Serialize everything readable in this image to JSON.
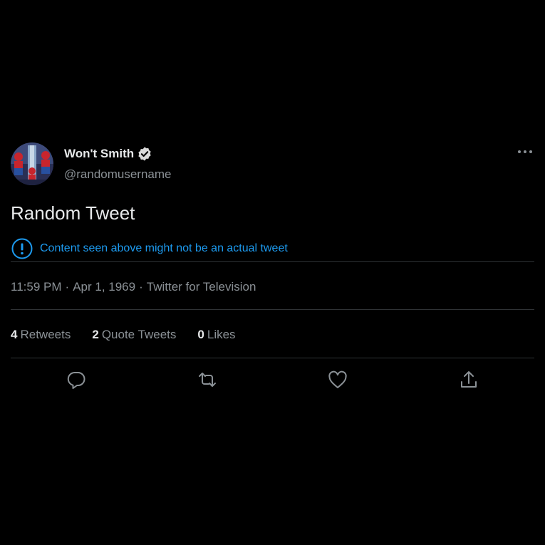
{
  "author": {
    "display_name": "Won't Smith",
    "handle": "@randomusername"
  },
  "tweet": {
    "text": "Random Tweet",
    "notice": "Content seen above might not be an actual tweet"
  },
  "meta": {
    "time": "11:59 PM",
    "date": "Apr 1, 1969",
    "source": "Twitter for Television",
    "separator": "·"
  },
  "stats": {
    "retweets_count": "4",
    "retweets_label": "Retweets",
    "quotes_count": "2",
    "quotes_label": "Quote Tweets",
    "likes_count": "0",
    "likes_label": "Likes"
  },
  "icons": {
    "verified": "verified-badge-icon",
    "more": "more-icon",
    "notice": "exclamation-circle-icon",
    "reply": "reply-icon",
    "retweet": "retweet-icon",
    "like": "heart-icon",
    "share": "share-icon"
  },
  "colors": {
    "background": "#000000",
    "text_primary": "#e7e9ea",
    "text_secondary": "#8b9196",
    "accent": "#1d9bf0",
    "divider": "#2f3336"
  }
}
